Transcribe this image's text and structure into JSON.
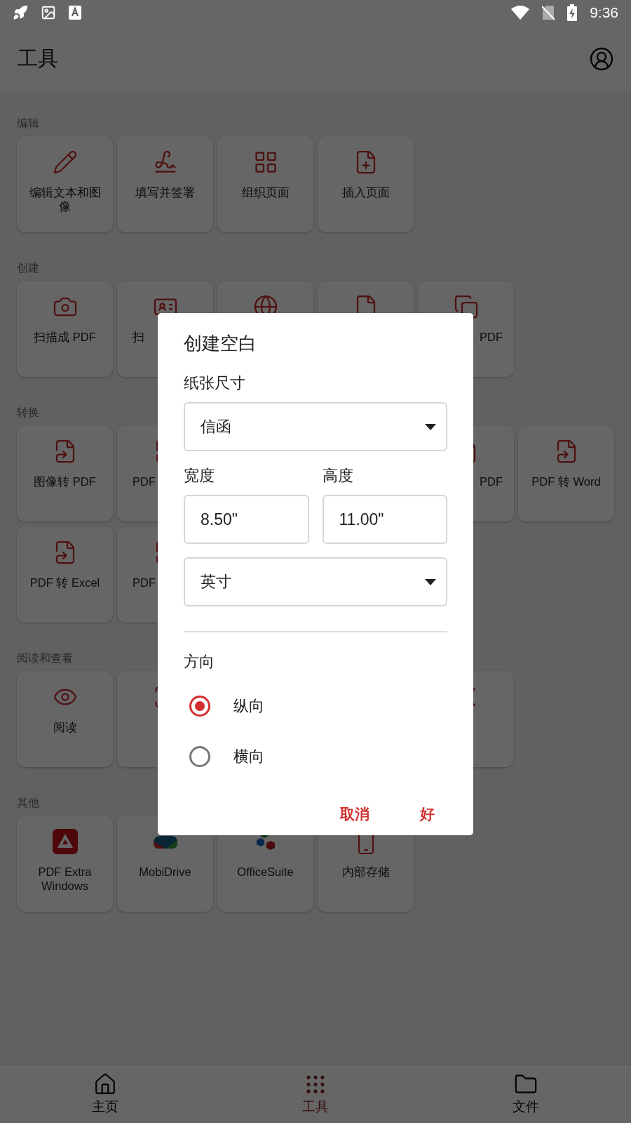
{
  "status_bar": {
    "time": "9:36"
  },
  "app_bar": {
    "title": "工具"
  },
  "sections": [
    {
      "title": "编辑",
      "tiles": [
        {
          "kind": "tool",
          "label": "编辑文本和图像"
        },
        {
          "kind": "tool",
          "label": "填写并签署"
        },
        {
          "kind": "tool",
          "label": "组织页面"
        },
        {
          "kind": "tool",
          "label": "插入页面"
        }
      ]
    },
    {
      "title": "创建",
      "tiles": [
        {
          "kind": "tool",
          "label": "扫描成 PDF"
        },
        {
          "kind": "tool",
          "label": "扫"
        },
        {
          "kind": "tool"
        },
        {
          "kind": "tool"
        },
        {
          "kind": "tool",
          "label": "PDF"
        }
      ]
    },
    {
      "title": "转换",
      "tiles": [
        {
          "kind": "tool",
          "label": "图像转 PDF"
        },
        {
          "kind": "tool",
          "label": "PDF"
        },
        {
          "kind": "tool",
          "label": "PDF"
        },
        {
          "kind": "tool",
          "label": "PDF 转 Word"
        },
        {
          "kind": "tool",
          "label": "PDF 转 Excel"
        },
        {
          "kind": "tool",
          "label": "PDF"
        }
      ]
    },
    {
      "title": "阅读和查看",
      "tiles": [
        {
          "kind": "tool",
          "label": "阅读"
        },
        {
          "kind": "tool"
        },
        {
          "kind": "tool"
        }
      ]
    },
    {
      "title": "其他",
      "tiles": [
        {
          "kind": "app",
          "label": "PDF Extra Windows"
        },
        {
          "kind": "app",
          "label": "MobiDrive"
        },
        {
          "kind": "app",
          "label": "OfficeSuite"
        },
        {
          "kind": "app",
          "label": "内部存储"
        }
      ]
    }
  ],
  "dialog": {
    "title": "创建空白",
    "paper_size": {
      "label": "纸张尺寸",
      "value": "信函"
    },
    "width": {
      "label": "宽度",
      "value": "8.50\""
    },
    "height": {
      "label": "高度",
      "value": "11.00\""
    },
    "units": {
      "value": "英寸"
    },
    "orientation": {
      "label": "方向",
      "options": [
        {
          "label": "纵向",
          "selected": true
        },
        {
          "label": "横向",
          "selected": false
        }
      ]
    },
    "buttons": [
      "取消",
      "好"
    ]
  },
  "bottom_nav": [
    {
      "label": "主页",
      "selected": false
    },
    {
      "label": "工具",
      "selected": true
    },
    {
      "label": "文件",
      "selected": false
    }
  ]
}
